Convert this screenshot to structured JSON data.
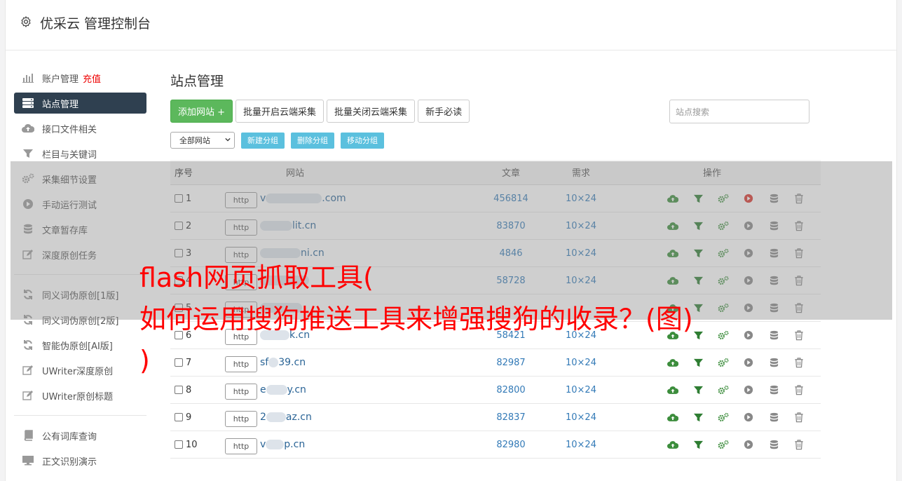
{
  "header": {
    "title": "优采云 管理控制台"
  },
  "sidebar": {
    "items": [
      {
        "label": "账户管理",
        "extra": "充值",
        "icon": "bar-chart-icon"
      },
      {
        "label": "站点管理",
        "icon": "server-icon",
        "active": true
      },
      {
        "label": "接口文件相关",
        "icon": "cloud-upload-icon"
      },
      {
        "label": "栏目与关键词",
        "icon": "filter-icon"
      },
      {
        "label": "采集细节设置",
        "icon": "cogs-icon"
      },
      {
        "label": "手动运行测试",
        "icon": "play-circle-icon"
      },
      {
        "label": "文章暂存库",
        "icon": "database-icon"
      },
      {
        "label": "深度原创任务",
        "icon": "edit-icon"
      }
    ],
    "items2": [
      {
        "label": "同义词伪原创[1版]",
        "icon": "refresh-icon"
      },
      {
        "label": "同义词伪原创[2版]",
        "icon": "refresh-icon"
      },
      {
        "label": "智能伪原创[AI版]",
        "icon": "refresh-icon"
      },
      {
        "label": "UWriter深度原创",
        "icon": "edit-icon"
      },
      {
        "label": "UWriter原创标题",
        "icon": "edit-icon"
      }
    ],
    "items3": [
      {
        "label": "公有词库查询",
        "icon": "book-icon"
      },
      {
        "label": "正文识别演示",
        "icon": "monitor-icon"
      }
    ]
  },
  "main": {
    "title": "站点管理",
    "buttons": {
      "add": "添加网站 +",
      "batch_on": "批量开启云端采集",
      "batch_off": "批量关闭云端采集",
      "guide": "新手必读"
    },
    "search_placeholder": "站点搜索",
    "select_value": "全部网站",
    "group_buttons": {
      "new": "新建分组",
      "del": "删除分组",
      "move": "移动分组"
    }
  },
  "table": {
    "headers": {
      "no": "序号",
      "site": "网站",
      "articles": "文章",
      "demand": "需求",
      "ops": "操作"
    },
    "http_label": "http",
    "rows": [
      {
        "no": "1",
        "pre": "v",
        "post": ".com",
        "articles": "456814",
        "demand": "10×24",
        "running": true
      },
      {
        "no": "2",
        "pre": "",
        "post": "lit.cn",
        "articles": "83870",
        "demand": "10×24",
        "running": false
      },
      {
        "no": "3",
        "pre": "",
        "post": "ni.cn",
        "articles": "4846",
        "demand": "10×24",
        "running": false
      },
      {
        "no": "4",
        "pre": "",
        "post": "",
        "articles": "58728",
        "demand": "10×24",
        "running": false
      },
      {
        "no": "5",
        "pre": "",
        "post": "",
        "articles": "",
        "demand": "",
        "running": false
      },
      {
        "no": "6",
        "pre": "",
        "post": "k.cn",
        "articles": "58421",
        "demand": "10×24",
        "running": false
      },
      {
        "no": "7",
        "pre": "sf",
        "post": "39.cn",
        "articles": "82987",
        "demand": "10×24",
        "running": false
      },
      {
        "no": "8",
        "pre": "e",
        "post": "y.cn",
        "articles": "82800",
        "demand": "10×24",
        "running": false
      },
      {
        "no": "9",
        "pre": "2",
        "post": "az.cn",
        "articles": "82837",
        "demand": "10×24",
        "running": false
      },
      {
        "no": "10",
        "pre": "v",
        "post": "p.cn",
        "articles": "82980",
        "demand": "10×24",
        "running": false
      }
    ]
  },
  "overlay": {
    "line1": "flash网页抓取工具(",
    "line2": "如何运用搜狗推送工具来增强搜狗的收录？(图)",
    "line3": ")"
  },
  "colors": {
    "sidebar_active": "#2f4050",
    "green": "#5cb85c",
    "info": "#5bc0de",
    "overlay_text": "#ff0000"
  }
}
